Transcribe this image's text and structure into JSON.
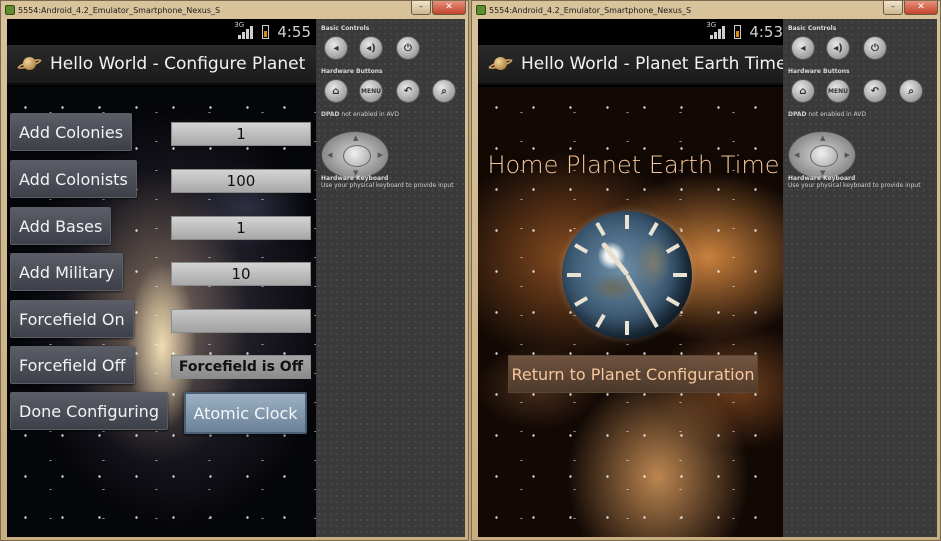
{
  "left_window": {
    "title": "5554:Android_4.2_Emulator_Smartphone_Nexus_S",
    "status": {
      "network": "3G",
      "time": "4:55"
    },
    "actionbar_title": "Hello World - Configure Planet",
    "rows": [
      {
        "button": "Add Colonies",
        "value": "1"
      },
      {
        "button": "Add Colonists",
        "value": "100"
      },
      {
        "button": "Add Bases",
        "value": "1"
      },
      {
        "button": "Add Military",
        "value": "10"
      },
      {
        "button": "Forcefield On",
        "value": ""
      },
      {
        "button": "Forcefield Off",
        "value": "Forcefield is Off"
      },
      {
        "button": "Done Configuring"
      }
    ],
    "clock_button": "Atomic Clock"
  },
  "right_window": {
    "title": "5554:Android_4.2_Emulator_Smartphone_Nexus_S",
    "status": {
      "network": "3G",
      "time": "4:53"
    },
    "actionbar_title": "Hello World - Planet Earth Time",
    "heading": "Home Planet Earth Time",
    "return_button": "Return to Planet Configuration"
  },
  "controls": {
    "basic_controls": "Basic Controls",
    "hardware_buttons": "Hardware Buttons",
    "menu_label": "MENU",
    "dpad_label": "DPAD",
    "dpad_note": "not enabled in AVD",
    "keyboard_label": "Hardware Keyboard",
    "keyboard_note": "Use your physical keyboard to provide input"
  },
  "colors": {
    "field_text": "#111111",
    "earth_heading": "#f6c79c",
    "clock_button": "#7f95aa"
  }
}
